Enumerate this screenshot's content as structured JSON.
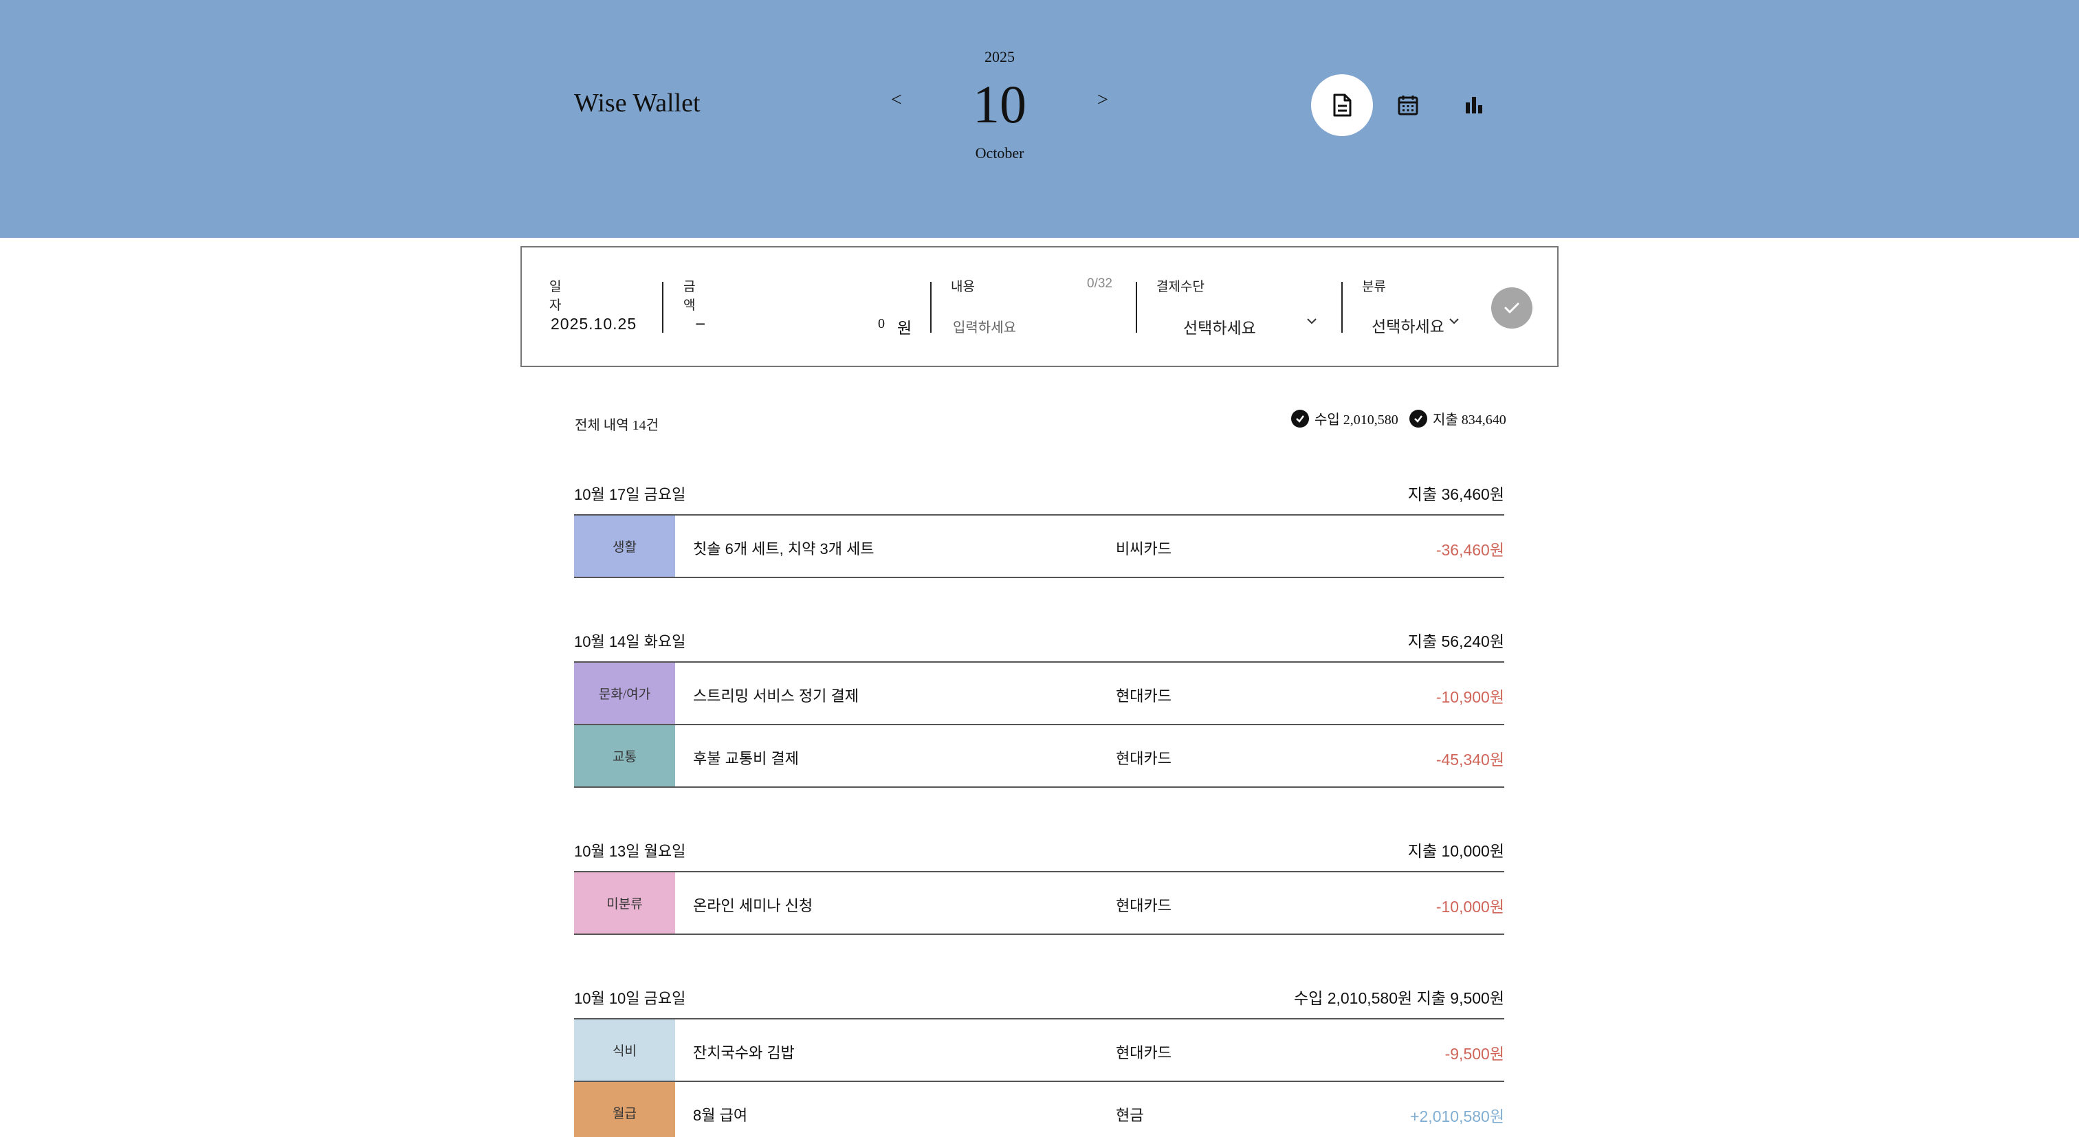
{
  "app": {
    "title": "Wise Wallet",
    "year": "2025",
    "month_num": "10",
    "month_name": "October",
    "prev": "<",
    "next": ">",
    "views": [
      {
        "icon": "document-icon",
        "active": true
      },
      {
        "icon": "calendar-icon",
        "active": false
      },
      {
        "icon": "bar-chart-icon",
        "active": false
      }
    ]
  },
  "form": {
    "date_label": "일자",
    "date_value": "2025.10.25",
    "amount_label": "금액",
    "amount_sign": "−",
    "amount_value": "0",
    "amount_unit": "원",
    "memo_label": "내용",
    "memo_count": "0/32",
    "memo_placeholder": "입력하세요",
    "pay_label": "결제수단",
    "pay_value": "선택하세요",
    "cat_label": "분류",
    "cat_value": "선택하세요"
  },
  "summary": {
    "total": "전체 내역 14건",
    "income": "수입 2,010,580",
    "expense": "지출 834,640"
  },
  "days": [
    {
      "date": "10월 17일 금요일",
      "sum": "지출  36,460원",
      "rows": [
        {
          "category": "생활",
          "color": "#a7b5e5",
          "desc": "칫솔 6개 세트, 치약 3개 세트",
          "pay": "비씨카드",
          "amount": "-36,460원",
          "type": "expense"
        }
      ]
    },
    {
      "date": "10월 14일 화요일",
      "sum": "지출  56,240원",
      "rows": [
        {
          "category": "문화/여가",
          "color": "#b7a6de",
          "desc": "스트리밍 서비스 정기 결제",
          "pay": "현대카드",
          "amount": "-10,900원",
          "type": "expense"
        },
        {
          "category": "교통",
          "color": "#89b8bd",
          "desc": "후불 교통비 결제",
          "pay": "현대카드",
          "amount": "-45,340원",
          "type": "expense"
        }
      ]
    },
    {
      "date": "10월 13일 월요일",
      "sum": "지출  10,000원",
      "rows": [
        {
          "category": "미분류",
          "color": "#e9b4d2",
          "desc": "온라인 세미나 신청",
          "pay": "현대카드",
          "amount": "-10,000원",
          "type": "expense"
        }
      ]
    },
    {
      "date": "10월 10일 금요일",
      "sum": "수입  2,010,580원  지출  9,500원",
      "rows": [
        {
          "category": "식비",
          "color": "#c9dde9",
          "desc": "잔치국수와 김밥",
          "pay": "현대카드",
          "amount": "-9,500원",
          "type": "expense"
        },
        {
          "category": "월급",
          "color": "#dea16c",
          "desc": "8월 급여",
          "pay": "현금",
          "amount": "+2,010,580원",
          "type": "income"
        }
      ]
    }
  ]
}
